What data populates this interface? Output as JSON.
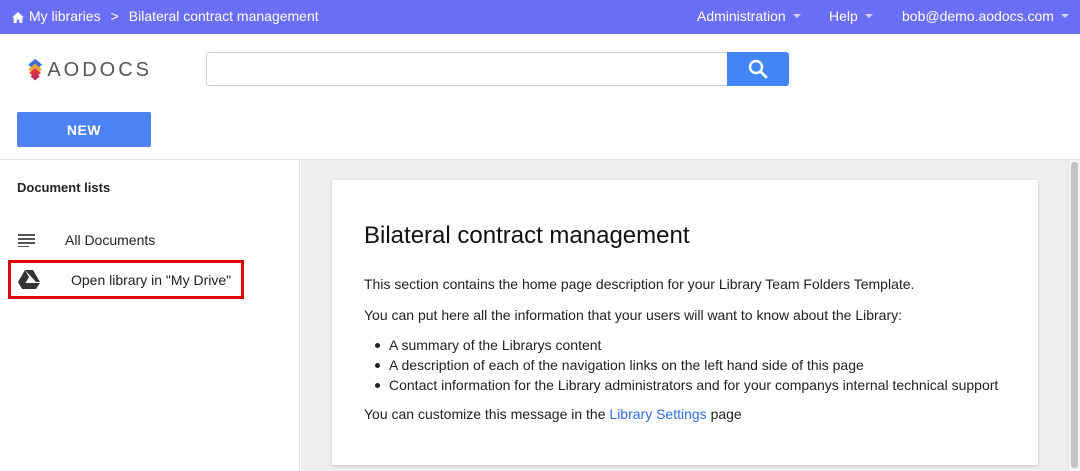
{
  "topbar": {
    "home_label": "My libraries",
    "separator": ">",
    "library_title": "Bilateral contract management",
    "menu_admin": "Administration",
    "menu_help": "Help",
    "user_email": "bob@demo.aodocs.com"
  },
  "header": {
    "logo_text": "AODOCS",
    "search_placeholder": "",
    "search_value": "",
    "new_button_label": "NEW"
  },
  "sidebar": {
    "title": "Document lists",
    "items": [
      {
        "label": "All Documents",
        "icon": "list-icon"
      },
      {
        "label": "Open library in \"My Drive\"",
        "icon": "google-drive-icon"
      }
    ]
  },
  "main": {
    "heading": "Bilateral contract management",
    "intro": "This section contains the home page description for your Library Team Folders Template.",
    "info": "You can put here all the information that your users will want to know about the Library:",
    "bullets": [
      "A summary of the Librarys content",
      "A description of each of the navigation links on the left hand side of this page",
      "Contact information for the Library administrators and for your companys internal technical support"
    ],
    "customize_prefix": "You can customize this message in the",
    "customize_link": "Library Settings",
    "customize_suffix": "page"
  },
  "colors": {
    "topbar": "#6a6ef5",
    "accent": "#4285f4",
    "highlight": "#e00000",
    "link": "#2f6fe0"
  }
}
